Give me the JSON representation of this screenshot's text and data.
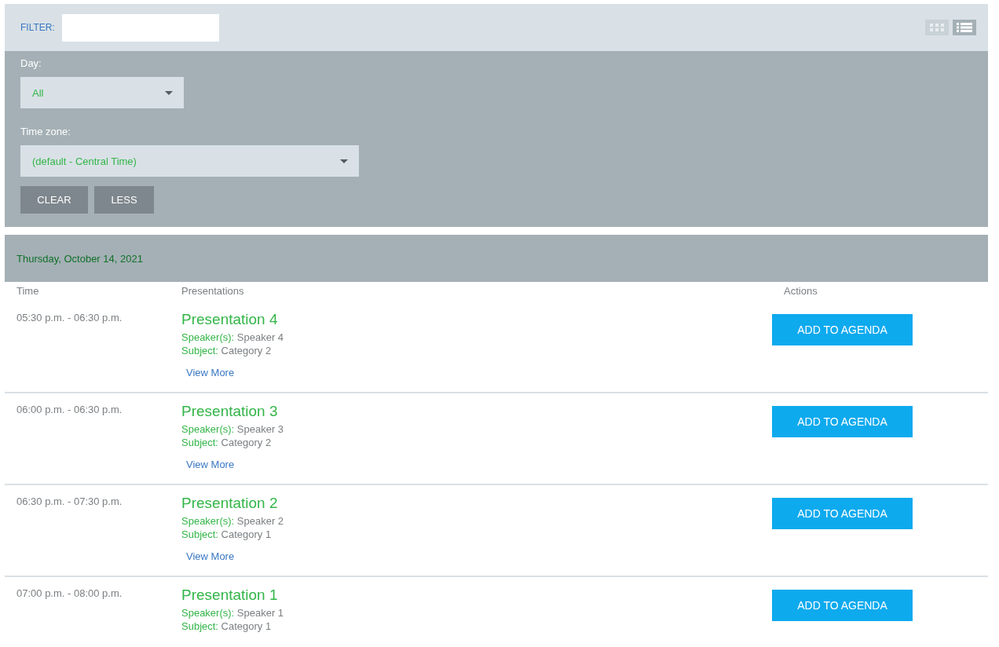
{
  "toolbar": {
    "filter_label": "FILTER:",
    "view_modes": [
      {
        "kind": "grid",
        "selected": false
      },
      {
        "kind": "list",
        "selected": true
      }
    ]
  },
  "filters": {
    "day": {
      "label": "Day:",
      "value": "All"
    },
    "time_zone": {
      "label": "Time zone:",
      "value": "(default - Central Time)"
    },
    "buttons": [
      "CLEAR",
      "LESS"
    ]
  },
  "schedule": {
    "date": "Thursday, October 14, 2021",
    "columns": [
      "Time",
      "Presentations",
      "Actions"
    ],
    "rows": [
      {
        "time": "05:30 p.m. - 06:30 p.m.",
        "title": "Presentation 4",
        "speaker_label": "Speaker(s):",
        "speaker": "Speaker 4",
        "subject_label": "Subject:",
        "subject": "Category 2",
        "view_more": "View More",
        "action": "ADD TO AGENDA"
      },
      {
        "time": "06:00 p.m. - 06:30 p.m.",
        "title": "Presentation 3",
        "speaker_label": "Speaker(s):",
        "speaker": "Speaker 3",
        "subject_label": "Subject:",
        "subject": "Category 2",
        "view_more": "View More",
        "action": "ADD TO AGENDA"
      },
      {
        "time": "06:30 p.m. - 07:30 p.m.",
        "title": "Presentation 2",
        "speaker_label": "Speaker(s):",
        "speaker": "Speaker 2",
        "subject_label": "Subject:",
        "subject": "Category 1",
        "view_more": "View More",
        "action": "ADD TO AGENDA"
      },
      {
        "time": "07:00 p.m. - 08:00 p.m.",
        "title": "Presentation 1",
        "speaker_label": "Speaker(s):",
        "speaker": "Speaker 1",
        "subject_label": "Subject:",
        "subject": "Category 1",
        "action": "ADD TO AGENDA"
      }
    ]
  }
}
